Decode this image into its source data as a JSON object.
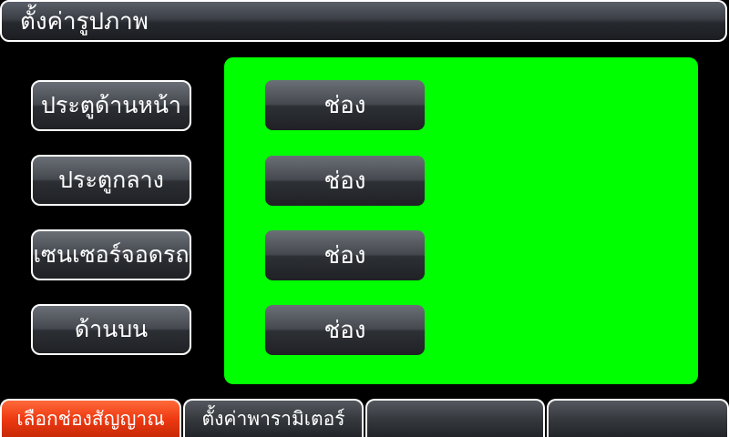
{
  "header": {
    "title": "ตั้งค่ารูปภาพ"
  },
  "sidebar": {
    "items": [
      {
        "label": "ประตูด้านหน้า"
      },
      {
        "label": "ประตูกลาง"
      },
      {
        "label": "เซนเซอร์จอดรถ"
      },
      {
        "label": "ด้านบน"
      }
    ]
  },
  "preview": {
    "background_color": "#00ff00"
  },
  "channels": [
    {
      "label": "ช่อง"
    },
    {
      "label": "ช่อง"
    },
    {
      "label": "ช่อง"
    },
    {
      "label": "ช่อง"
    }
  ],
  "tabs": [
    {
      "label": "เลือกช่องสัญญาณ",
      "active": true
    },
    {
      "label": "ตั้งค่าพารามิเตอร์",
      "active": false
    },
    {
      "label": "",
      "active": false
    },
    {
      "label": "",
      "active": false
    }
  ],
  "colors": {
    "active_tab": "#ee3a12",
    "preview": "#00ff00"
  }
}
